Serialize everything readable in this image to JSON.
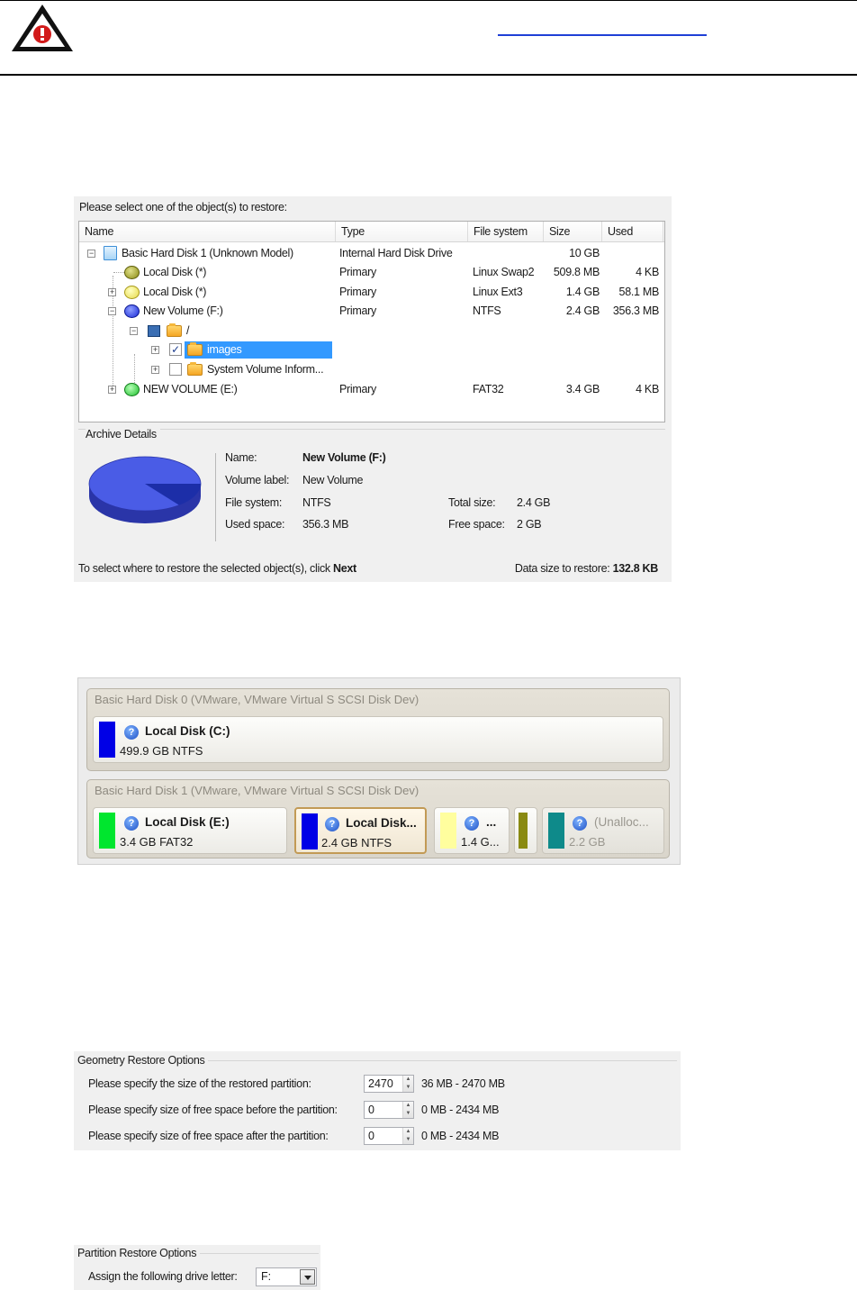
{
  "warning": {
    "icon": "warning-triangle-icon"
  },
  "restore_objects": {
    "prompt": "Please select one of the object(s) to restore:",
    "columns": [
      "Name",
      "Type",
      "File system",
      "Size",
      "Used"
    ],
    "rows": [
      {
        "name": "Basic Hard Disk 1 (Unknown Model)",
        "type": "Internal Hard Disk Drive",
        "fs": "",
        "size": "10 GB",
        "used": ""
      },
      {
        "name": "Local Disk (*)",
        "type": "Primary",
        "fs": "Linux Swap2",
        "size": "509.8 MB",
        "used": "4 KB"
      },
      {
        "name": "Local Disk (*)",
        "type": "Primary",
        "fs": "Linux Ext3",
        "size": "1.4 GB",
        "used": "58.1 MB"
      },
      {
        "name": "New Volume (F:)",
        "type": "Primary",
        "fs": "NTFS",
        "size": "2.4 GB",
        "used": "356.3 MB"
      },
      {
        "name": "/",
        "type": "",
        "fs": "",
        "size": "",
        "used": ""
      },
      {
        "name": "images",
        "type": "",
        "fs": "",
        "size": "",
        "used": ""
      },
      {
        "name": "System Volume Inform...",
        "type": "",
        "fs": "",
        "size": "",
        "used": ""
      },
      {
        "name": "NEW VOLUME (E:)",
        "type": "Primary",
        "fs": "FAT32",
        "size": "3.4 GB",
        "used": "4 KB"
      }
    ],
    "archive_details": {
      "title": "Archive Details",
      "name_label": "Name:",
      "name_value": "New Volume (F:)",
      "volume_label_label": "Volume label:",
      "volume_label_value": "New Volume",
      "fs_label": "File system:",
      "fs_value": "NTFS",
      "used_label": "Used space:",
      "used_value": "356.3 MB",
      "total_label": "Total size:",
      "total_value": "2.4 GB",
      "free_label": "Free space:",
      "free_value": "2 GB",
      "used_fraction": 0.145,
      "pie_color": "#4a5ce6",
      "pie_used_color": "#1c2ea8"
    },
    "footer": {
      "hint_prefix": "To select where to restore the selected object(s), click ",
      "hint_bold": "Next",
      "size_label": "Data size to restore: ",
      "size_value": "132.8 KB"
    }
  },
  "disk_map": {
    "disks": [
      {
        "title": "Basic Hard Disk 0 (VMware, VMware Virtual S SCSI Disk Dev)",
        "partitions": [
          {
            "name": "Local Disk (C:)",
            "sub": "499.9 GB NTFS",
            "color": "#0000e6"
          }
        ]
      },
      {
        "title": "Basic Hard Disk 1 (VMware, VMware Virtual S SCSI Disk Dev)",
        "partitions": [
          {
            "name": "Local Disk (E:)",
            "sub": "3.4 GB FAT32",
            "color": "#00e62e"
          },
          {
            "name": "Local Disk...",
            "sub": "2.4 GB NTFS",
            "color": "#0000e6"
          },
          {
            "name": "...",
            "sub": "1.4 G...",
            "color": "#fffe9e"
          },
          {
            "name": "",
            "sub": "",
            "color": "#8a8a12"
          },
          {
            "name": "(Unalloc...",
            "sub": "2.2 GB",
            "color": "#0e8a8a"
          }
        ]
      }
    ]
  },
  "geometry": {
    "title": "Geometry Restore Options",
    "rows": [
      {
        "label": "Please specify the size of the restored partition:",
        "value": "2470",
        "range": "36 MB - 2470 MB"
      },
      {
        "label": "Please specify size of free space before the partition:",
        "value": "0",
        "range": "0 MB - 2434 MB"
      },
      {
        "label": "Please specify size of free space after the partition:",
        "value": "0",
        "range": "0 MB - 2434 MB"
      }
    ]
  },
  "partition_options": {
    "title": "Partition Restore Options",
    "label": "Assign the following drive letter:",
    "value": "F:"
  }
}
